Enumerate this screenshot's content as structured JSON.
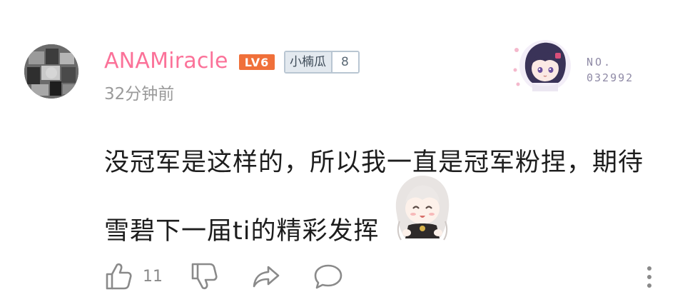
{
  "comment": {
    "username": "ANAMiracle",
    "level_badge": "LV6",
    "fan_badge": {
      "name": "小楠瓜",
      "level": "8"
    },
    "time": "32分钟前",
    "text_lines": [
      "没冠军是这样的，所以我一直是冠军粉捏，期待",
      "雪碧下一届ti的精彩发挥"
    ],
    "decoration_card": {
      "label": "NO.",
      "number": "032992"
    },
    "actions": {
      "like_count": "11"
    }
  },
  "colors": {
    "username": "#fb7299",
    "level_badge": "#f0703a",
    "text": "#1d1d1d",
    "meta": "#9a9a9a",
    "icon": "#8a8a8a"
  },
  "icons": [
    "thumbs-up-icon",
    "thumbs-down-icon",
    "share-icon",
    "comment-icon",
    "more-vertical-icon"
  ]
}
